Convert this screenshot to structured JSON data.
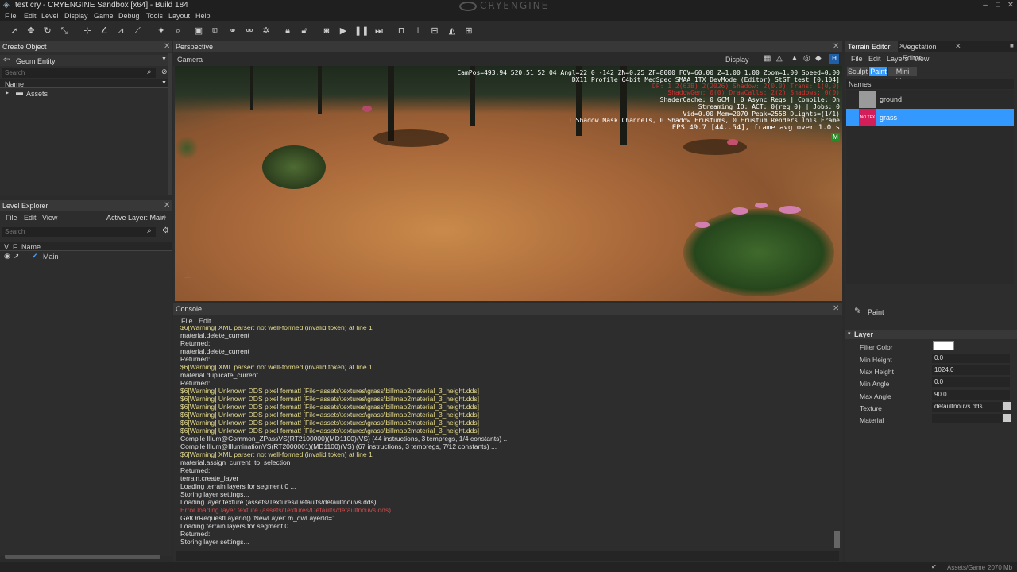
{
  "window": {
    "title": "test.cry - CRYENGINE Sandbox [x64] - Build 184",
    "brand": "CRYENGINE",
    "controls": {
      "minimize": "–",
      "maximize": "□",
      "close": "✕"
    }
  },
  "menu": [
    "File",
    "Edit",
    "Level",
    "Display",
    "Game",
    "Debug",
    "Tools",
    "Layout",
    "Help"
  ],
  "create_object": {
    "title": "Create Object",
    "category": "Geom Entity",
    "search_placeholder": "Search",
    "column_name": "Name",
    "tree": [
      {
        "label": "Assets"
      }
    ]
  },
  "level_explorer": {
    "title": "Level Explorer",
    "menu": [
      "File",
      "Edit",
      "View"
    ],
    "active_layer": "Active Layer: Main",
    "search_placeholder": "Search",
    "columns": {
      "v": "V",
      "f": "F",
      "name": "Name"
    },
    "layers": [
      {
        "label": "Main"
      }
    ]
  },
  "perspective": {
    "title": "Perspective",
    "camera_label": "Camera",
    "display_label": "Display",
    "h_badge": "H",
    "m_badge": "M",
    "overlay_white": [
      "CamPos=493.94 520.51 52.04 Angl=22  0 -142 ZN=0.25 ZF=8000 FOV=60.00 Z=1.00 1.00 Zoom=1.00 Speed=0.00",
      "DX11 Profile 64bit MedSpec SMAA 1TX DevMode (Editor) StGT test [0.104]"
    ],
    "overlay_red": [
      "DP: 1  2(63B) 2(2026)  Shadow: 2(0.0)  Trans: 1(0,0)",
      "ShadowGen: 0(0)  DrawCalls: 2(2)  Shadows: 0(0)"
    ],
    "overlay_white2": [
      "ShaderCache: 0 GCM | 0 Async Reqs | Compile: On",
      "Streaming IO: ACT:  0(req  0) | Jobs: 0",
      "Vid=0.00 Mem=2070 Peak=2558 DLights=(1/1)",
      "1 Shadow Mask Channels,  0 Shadow Frustums,  0 Frustum Renders This Frame",
      "FPS 49.7 [44..54], frame avg over 1.0 s"
    ]
  },
  "console": {
    "title": "Console",
    "menu": [
      "File",
      "Edit"
    ],
    "lines": [
      {
        "text": "$6[Warning] XML parser: not well-formed (invalid token) at line 1",
        "kind": "warn"
      },
      {
        "text": "material.delete_current",
        "kind": "info"
      },
      {
        "text": "Returned:",
        "kind": "info"
      },
      {
        "text": "material.delete_current",
        "kind": "info"
      },
      {
        "text": "Returned:",
        "kind": "info"
      },
      {
        "text": "$6[Warning] XML parser: not well-formed (invalid token) at line 1",
        "kind": "warn"
      },
      {
        "text": "material.duplicate_current",
        "kind": "info"
      },
      {
        "text": "Returned:",
        "kind": "info"
      },
      {
        "text": "$6[Warning] Unknown DDS pixel format! [File=assets\\textures\\grass\\billmap2material_3_height.dds]",
        "kind": "warn"
      },
      {
        "text": "$6[Warning] Unknown DDS pixel format! [File=assets\\textures\\grass\\billmap2material_3_height.dds]",
        "kind": "warn"
      },
      {
        "text": "$6[Warning] Unknown DDS pixel format! [File=assets\\textures\\grass\\billmap2material_3_height.dds]",
        "kind": "warn"
      },
      {
        "text": "$6[Warning] Unknown DDS pixel format! [File=assets\\textures\\grass\\billmap2material_3_height.dds]",
        "kind": "warn"
      },
      {
        "text": "$6[Warning] Unknown DDS pixel format! [File=assets\\textures\\grass\\billmap2material_3_height.dds]",
        "kind": "warn"
      },
      {
        "text": "$6[Warning] Unknown DDS pixel format! [File=assets\\textures\\grass\\billmap2material_3_height.dds]",
        "kind": "warn"
      },
      {
        "text": "Compile Illum@Common_ZPassVS(RT2100000)(MD1100)(VS) (44 instructions, 3 tempregs, 1/4 constants) ...",
        "kind": "info"
      },
      {
        "text": "Compile Illum@IlluminationVS(RT2000001)(MD1100)(VS) (67 instructions, 3 tempregs, 7/12 constants) ...",
        "kind": "info"
      },
      {
        "text": "$6[Warning] XML parser: not well-formed (invalid token) at line 1",
        "kind": "warn"
      },
      {
        "text": "material.assign_current_to_selection",
        "kind": "info"
      },
      {
        "text": "Returned:",
        "kind": "info"
      },
      {
        "text": "terrain.create_layer",
        "kind": "info"
      },
      {
        "text": "Loading terrain layers for segment 0 ...",
        "kind": "info"
      },
      {
        "text": "Storing layer settings...",
        "kind": "info"
      },
      {
        "text": "Loading layer texture (assets/Textures/Defaults/defaultnouvs.dds)...",
        "kind": "info"
      },
      {
        "text": "Error loading layer texture (assets/Textures/Defaults/defaultnouvs.dds)...",
        "kind": "error"
      },
      {
        "text": "GetOrRequestLayerId() 'NewLayer' m_dwLayerId=1",
        "kind": "info"
      },
      {
        "text": "Loading terrain layers for segment 0 ...",
        "kind": "info"
      },
      {
        "text": "Returned:",
        "kind": "info"
      },
      {
        "text": "Storing layer settings...",
        "kind": "info"
      }
    ]
  },
  "terrain_editor": {
    "tabs": [
      "Terrain Editor",
      "Vegetation Editor"
    ],
    "menu": [
      "File",
      "Edit",
      "Layers",
      "View"
    ],
    "modes": [
      "Sculpt",
      "Paint",
      "Mini Map"
    ],
    "names_header": "Names",
    "layers": [
      {
        "name": "ground"
      },
      {
        "name": "grass"
      }
    ],
    "grass_thumb_text": "NO TEX",
    "paint_label": "Paint",
    "section": "Layer",
    "props": {
      "filter_color": "Filter Color",
      "min_height": "Min Height",
      "min_height_val": "0.0",
      "max_height": "Max Height",
      "max_height_val": "1024.0",
      "min_angle": "Min Angle",
      "min_angle_val": "0.0",
      "max_angle": "Max Angle",
      "max_angle_val": "90.0",
      "texture": "Texture",
      "texture_val": "defaultnouvs.dds",
      "material": "Material",
      "material_val": ""
    }
  },
  "status": {
    "path": "Assets/Game",
    "mem": "2070 Mb"
  },
  "colors": {
    "accent": "#3399ff",
    "warn": "#e6dc8c",
    "error": "#d44a4a",
    "overlay_red": "#d03030",
    "panel_bg": "#2d2d2d",
    "header_bg": "#383838"
  }
}
